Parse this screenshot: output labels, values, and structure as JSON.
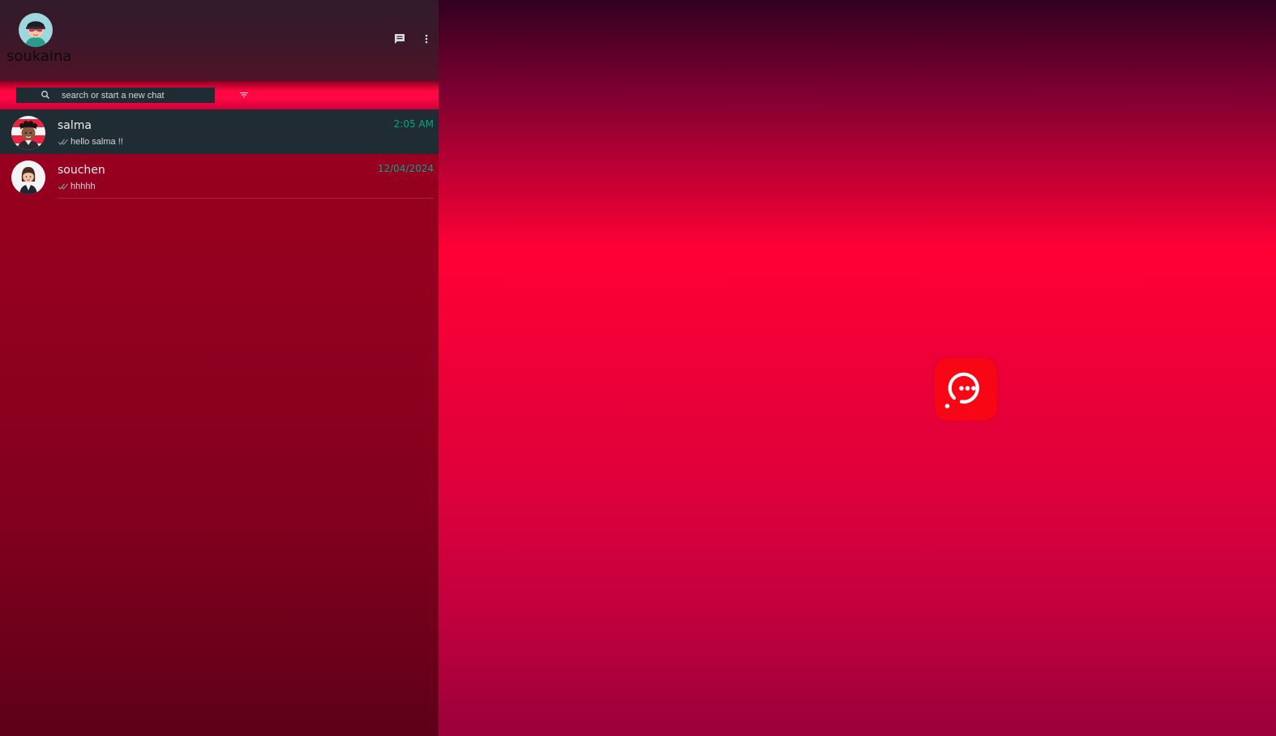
{
  "profile": {
    "user_name": "soukaina",
    "avatar": "cartoon-avatar-cap"
  },
  "header_icons": {
    "new_chat": "chat-bubble-icon",
    "menu": "vertical-dots-icon"
  },
  "search": {
    "placeholder": "search or start a new chat",
    "value": "",
    "icon": "search-icon",
    "filter_icon": "filter-icon"
  },
  "chats": [
    {
      "name": "salma",
      "time": "2:05 AM",
      "last_message": "hello salma !!",
      "status_icon": "double-check-icon",
      "active": true
    },
    {
      "name": "souchen",
      "time": "12/04/2024",
      "last_message": "hhhhh",
      "status_icon": "double-check-icon",
      "active": false
    }
  ],
  "colors": {
    "accent": "#00a884",
    "active_row": "#202c33",
    "logo": "#f80616"
  },
  "main": {
    "logo_icon": "chat-logo-icon"
  }
}
